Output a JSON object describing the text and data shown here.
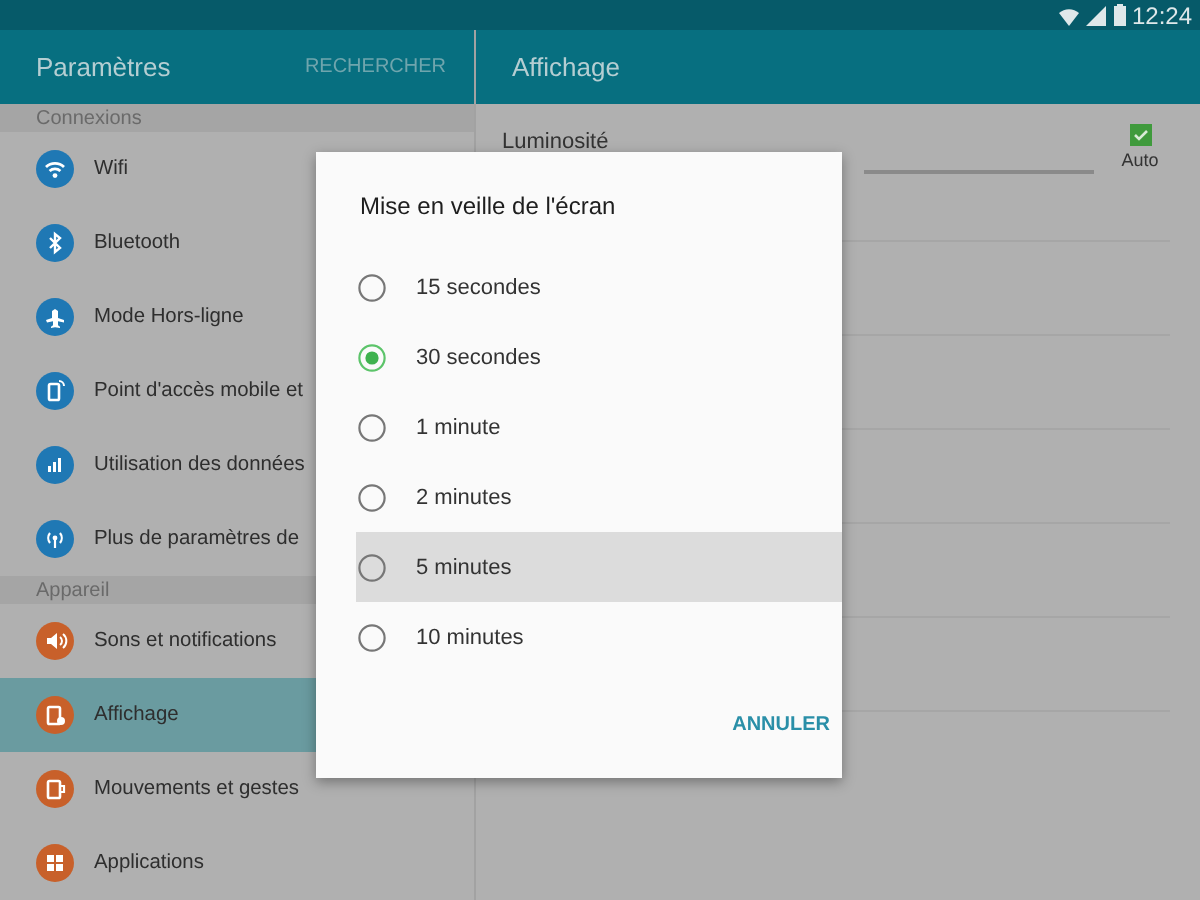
{
  "status_bar": {
    "time": "12:24"
  },
  "sidebar": {
    "title": "Paramètres",
    "search_button": "RECHERCHER",
    "sections": [
      {
        "header": "Connexions",
        "items": [
          {
            "label": "Wifi",
            "color": "#1f78b4",
            "selected": false
          },
          {
            "label": "Bluetooth",
            "color": "#1f78b4",
            "selected": false
          },
          {
            "label": "Mode Hors-ligne",
            "color": "#1f78b4",
            "selected": false
          },
          {
            "label": "Point d'accès mobile et",
            "color": "#1f78b4",
            "selected": false
          },
          {
            "label": "Utilisation des données",
            "color": "#1f78b4",
            "selected": false
          },
          {
            "label": "Plus de paramètres de",
            "color": "#1f78b4",
            "selected": false
          }
        ]
      },
      {
        "header": "Appareil",
        "items": [
          {
            "label": "Sons et notifications",
            "color": "#c8602a",
            "selected": false
          },
          {
            "label": "Affichage",
            "color": "#c8602a",
            "selected": true
          },
          {
            "label": "Mouvements et gestes",
            "color": "#c8602a",
            "selected": false
          },
          {
            "label": "Applications",
            "color": "#c8602a",
            "selected": false
          }
        ]
      }
    ]
  },
  "detail": {
    "title": "Affichage",
    "brightness_label": "Luminosité",
    "auto": {
      "label": "Auto",
      "checked": true
    }
  },
  "dialog": {
    "title": "Mise en veille de l'écran",
    "options": [
      {
        "label": "15 secondes",
        "selected": false,
        "pressed": false
      },
      {
        "label": "30 secondes",
        "selected": true,
        "pressed": false
      },
      {
        "label": "1 minute",
        "selected": false,
        "pressed": false
      },
      {
        "label": "2 minutes",
        "selected": false,
        "pressed": false
      },
      {
        "label": "5 minutes",
        "selected": false,
        "pressed": true
      },
      {
        "label": "10 minutes",
        "selected": false,
        "pressed": false
      }
    ],
    "buttons": [
      "ANNULER"
    ]
  }
}
